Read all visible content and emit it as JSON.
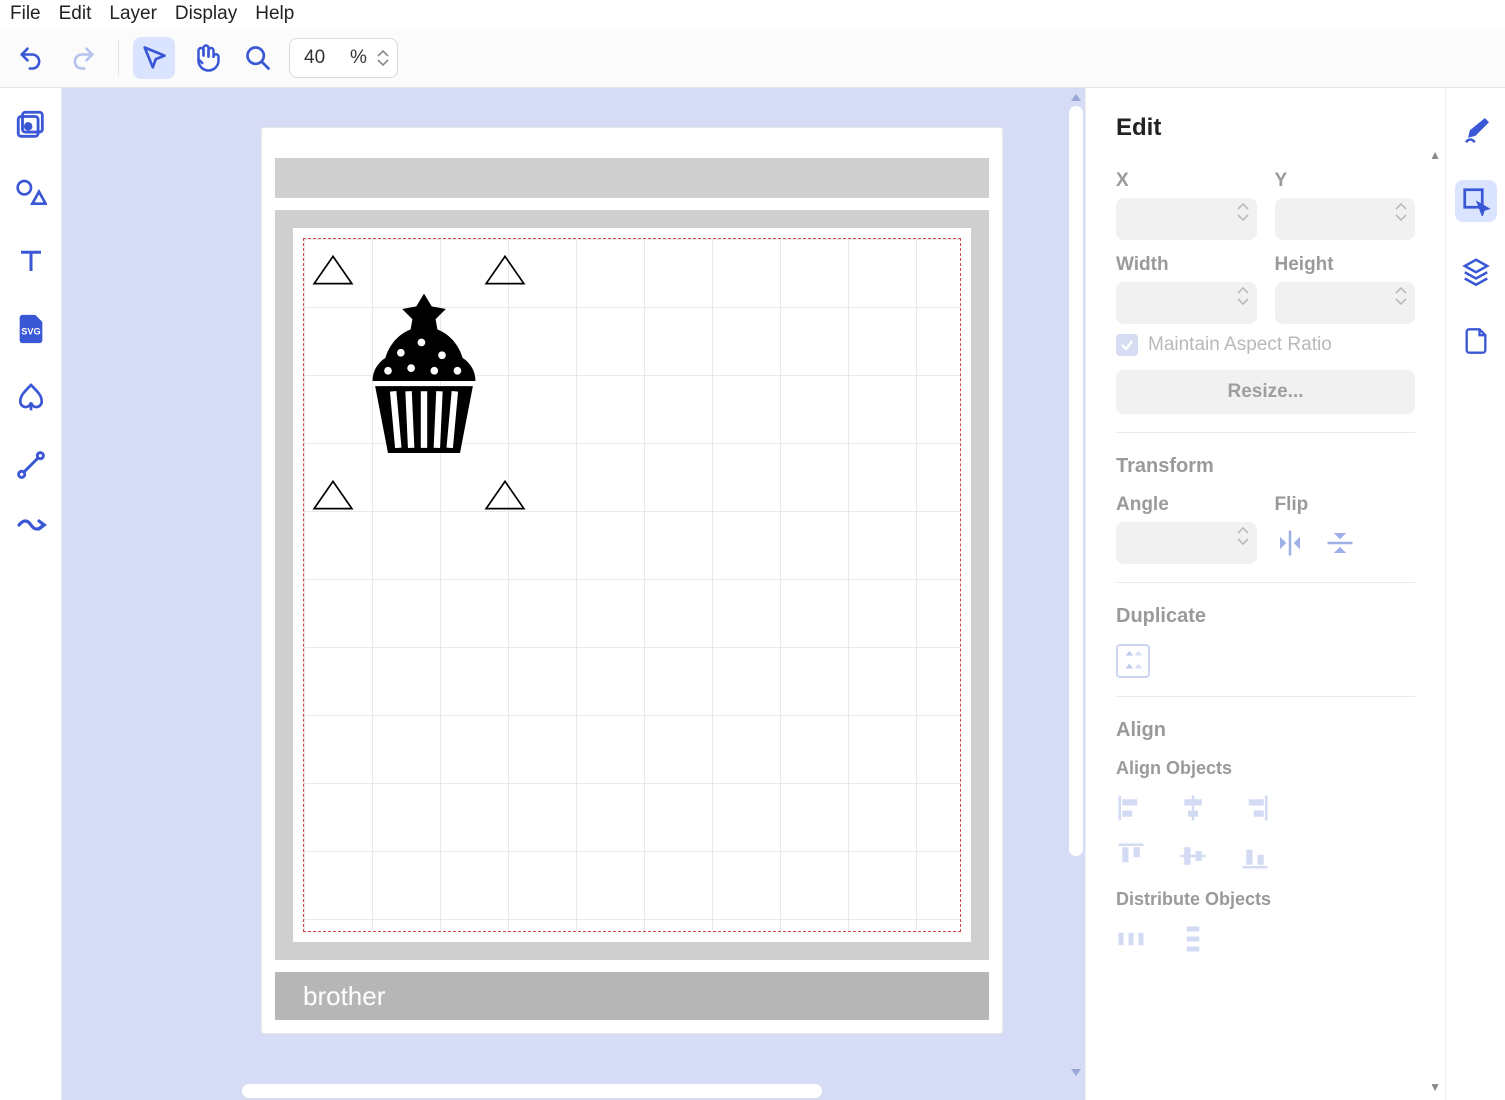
{
  "menubar": [
    "File",
    "Edit",
    "Layer",
    "Display",
    "Help"
  ],
  "toolbar": {
    "zoom_value": "40",
    "zoom_unit": "%"
  },
  "inspector": {
    "title": "Edit",
    "x_label": "X",
    "y_label": "Y",
    "width_label": "Width",
    "height_label": "Height",
    "aspect_label": "Maintain Aspect Ratio",
    "resize_btn": "Resize...",
    "transform_title": "Transform",
    "angle_label": "Angle",
    "flip_label": "Flip",
    "duplicate_title": "Duplicate",
    "align_title": "Align",
    "align_objects_label": "Align Objects",
    "distribute_label": "Distribute Objects"
  },
  "footer_brand": "brother"
}
